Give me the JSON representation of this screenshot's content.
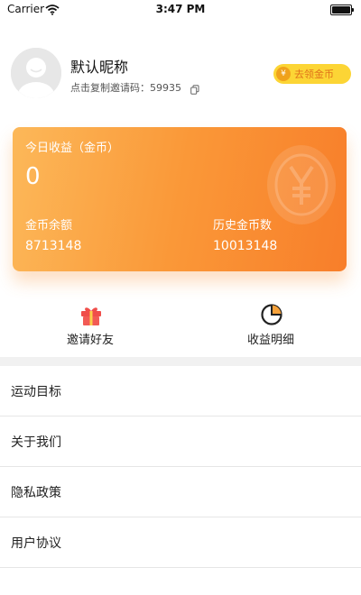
{
  "status_bar": {
    "carrier": "Carrier",
    "time": "3:47 PM"
  },
  "profile": {
    "nickname": "默认昵称",
    "invite_text": "点击复制邀请码：59935",
    "coin_button_label": "去领金币",
    "coin_symbol": "¥"
  },
  "earnings_card": {
    "today_label": "今日收益（金币）",
    "today_value": "0",
    "balance_label": "金币余额",
    "balance_value": "8713148",
    "history_label": "历史金币数",
    "history_value": "10013148",
    "gradient_colors": [
      "#fcb859",
      "#f87e2a"
    ]
  },
  "actions": {
    "invite_label": "邀请好友",
    "income_label": "收益明细",
    "invite_icon": "gift-icon",
    "income_icon": "pie-chart-icon"
  },
  "menu": {
    "items": [
      "运动目标",
      "关于我们",
      "隐私政策",
      "用户协议"
    ]
  },
  "colors": {
    "accent_orange": "#f98d33",
    "coin_button_bg": "#fcd535",
    "coin_text": "#e0731a"
  }
}
